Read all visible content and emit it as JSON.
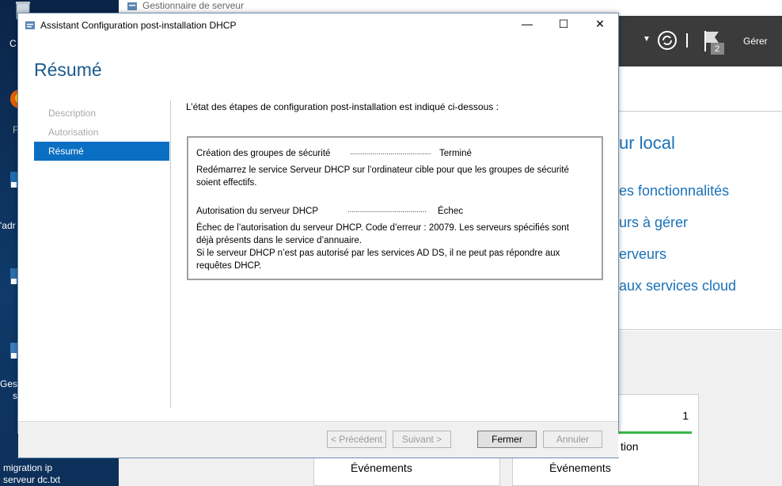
{
  "desktop": {
    "icon_labels": [
      "C",
      "F",
      "'adr",
      "Gesti",
      "s"
    ],
    "file_label_line1": "migration ip",
    "file_label_line2": "serveur dc.txt"
  },
  "server_manager": {
    "title": "Gestionnaire de serveur",
    "tools_label": "Gérer",
    "flag_count": "2",
    "heading_partial": "ur local",
    "links": [
      "es fonctionnalités",
      "urs à gérer",
      "erveurs",
      "aux services cloud"
    ],
    "tile_count": "1",
    "tile_text": "tion",
    "events_label_1": "Événements",
    "events_label_2": "Événements"
  },
  "wizard": {
    "title": "Assistant Configuration post-installation DHCP",
    "heading": "Résumé",
    "nav": [
      "Description",
      "Autorisation",
      "Résumé"
    ],
    "intro": "L’état des étapes de configuration post-installation est indiqué ci-dessous :",
    "results": {
      "step1_name": "Création des groupes de sécurité",
      "step1_dots": "........................................",
      "step1_status": "Terminé",
      "step1_msg_line1": "Redémarrez le service Serveur DHCP sur l’ordinateur cible pour que les groupes de sécurité",
      "step1_msg_line2": "soient effectifs.",
      "step2_name": "Autorisation du serveur DHCP",
      "step2_dots": ".......................................",
      "step2_status": "Échec",
      "step2_msg_line1": "Échec de l’autorisation du serveur DHCP. Code d’erreur : 20079. Les serveurs spécifiés sont",
      "step2_msg_line2": "déjà présents dans le service d’annuaire.",
      "step2_msg_line3": "Si le serveur DHCP n’est pas autorisé par les services AD DS, il ne peut pas répondre aux",
      "step2_msg_line4": "requêtes DHCP."
    },
    "buttons": {
      "previous": "< Précédent",
      "next": "Suivant >",
      "close": "Fermer",
      "cancel": "Annuler"
    },
    "controls": {
      "minimize": "—",
      "maximize": "☐",
      "close": "✕"
    }
  },
  "colors": {
    "accent": "#0a6fc2",
    "heading": "#1c5a8e",
    "link": "#1a71b8"
  }
}
